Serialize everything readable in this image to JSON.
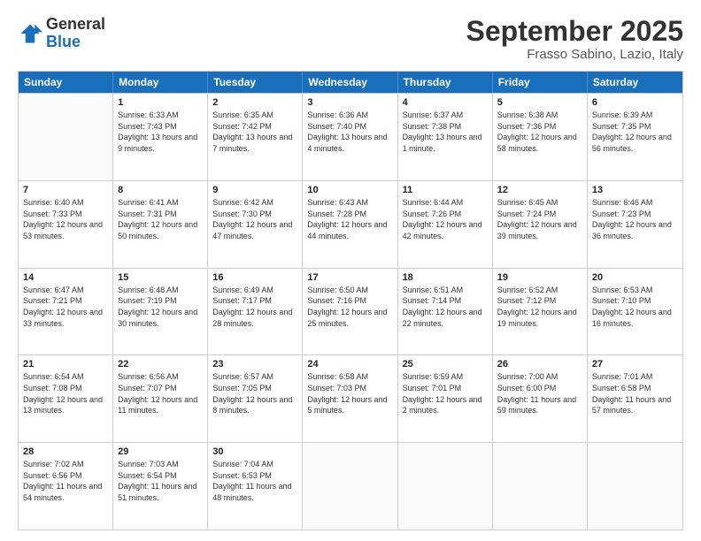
{
  "logo": {
    "general": "General",
    "blue": "Blue"
  },
  "header": {
    "month": "September 2025",
    "location": "Frasso Sabino, Lazio, Italy"
  },
  "days": [
    "Sunday",
    "Monday",
    "Tuesday",
    "Wednesday",
    "Thursday",
    "Friday",
    "Saturday"
  ],
  "rows": [
    [
      {
        "day": "",
        "sunrise": "",
        "sunset": "",
        "daylight": ""
      },
      {
        "day": "1",
        "sunrise": "Sunrise: 6:33 AM",
        "sunset": "Sunset: 7:43 PM",
        "daylight": "Daylight: 13 hours and 9 minutes."
      },
      {
        "day": "2",
        "sunrise": "Sunrise: 6:35 AM",
        "sunset": "Sunset: 7:42 PM",
        "daylight": "Daylight: 13 hours and 7 minutes."
      },
      {
        "day": "3",
        "sunrise": "Sunrise: 6:36 AM",
        "sunset": "Sunset: 7:40 PM",
        "daylight": "Daylight: 13 hours and 4 minutes."
      },
      {
        "day": "4",
        "sunrise": "Sunrise: 6:37 AM",
        "sunset": "Sunset: 7:38 PM",
        "daylight": "Daylight: 13 hours and 1 minute."
      },
      {
        "day": "5",
        "sunrise": "Sunrise: 6:38 AM",
        "sunset": "Sunset: 7:36 PM",
        "daylight": "Daylight: 12 hours and 58 minutes."
      },
      {
        "day": "6",
        "sunrise": "Sunrise: 6:39 AM",
        "sunset": "Sunset: 7:35 PM",
        "daylight": "Daylight: 12 hours and 56 minutes."
      }
    ],
    [
      {
        "day": "7",
        "sunrise": "Sunrise: 6:40 AM",
        "sunset": "Sunset: 7:33 PM",
        "daylight": "Daylight: 12 hours and 53 minutes."
      },
      {
        "day": "8",
        "sunrise": "Sunrise: 6:41 AM",
        "sunset": "Sunset: 7:31 PM",
        "daylight": "Daylight: 12 hours and 50 minutes."
      },
      {
        "day": "9",
        "sunrise": "Sunrise: 6:42 AM",
        "sunset": "Sunset: 7:30 PM",
        "daylight": "Daylight: 12 hours and 47 minutes."
      },
      {
        "day": "10",
        "sunrise": "Sunrise: 6:43 AM",
        "sunset": "Sunset: 7:28 PM",
        "daylight": "Daylight: 12 hours and 44 minutes."
      },
      {
        "day": "11",
        "sunrise": "Sunrise: 6:44 AM",
        "sunset": "Sunset: 7:26 PM",
        "daylight": "Daylight: 12 hours and 42 minutes."
      },
      {
        "day": "12",
        "sunrise": "Sunrise: 6:45 AM",
        "sunset": "Sunset: 7:24 PM",
        "daylight": "Daylight: 12 hours and 39 minutes."
      },
      {
        "day": "13",
        "sunrise": "Sunrise: 6:46 AM",
        "sunset": "Sunset: 7:23 PM",
        "daylight": "Daylight: 12 hours and 36 minutes."
      }
    ],
    [
      {
        "day": "14",
        "sunrise": "Sunrise: 6:47 AM",
        "sunset": "Sunset: 7:21 PM",
        "daylight": "Daylight: 12 hours and 33 minutes."
      },
      {
        "day": "15",
        "sunrise": "Sunrise: 6:48 AM",
        "sunset": "Sunset: 7:19 PM",
        "daylight": "Daylight: 12 hours and 30 minutes."
      },
      {
        "day": "16",
        "sunrise": "Sunrise: 6:49 AM",
        "sunset": "Sunset: 7:17 PM",
        "daylight": "Daylight: 12 hours and 28 minutes."
      },
      {
        "day": "17",
        "sunrise": "Sunrise: 6:50 AM",
        "sunset": "Sunset: 7:16 PM",
        "daylight": "Daylight: 12 hours and 25 minutes."
      },
      {
        "day": "18",
        "sunrise": "Sunrise: 6:51 AM",
        "sunset": "Sunset: 7:14 PM",
        "daylight": "Daylight: 12 hours and 22 minutes."
      },
      {
        "day": "19",
        "sunrise": "Sunrise: 6:52 AM",
        "sunset": "Sunset: 7:12 PM",
        "daylight": "Daylight: 12 hours and 19 minutes."
      },
      {
        "day": "20",
        "sunrise": "Sunrise: 6:53 AM",
        "sunset": "Sunset: 7:10 PM",
        "daylight": "Daylight: 12 hours and 16 minutes."
      }
    ],
    [
      {
        "day": "21",
        "sunrise": "Sunrise: 6:54 AM",
        "sunset": "Sunset: 7:08 PM",
        "daylight": "Daylight: 12 hours and 13 minutes."
      },
      {
        "day": "22",
        "sunrise": "Sunrise: 6:56 AM",
        "sunset": "Sunset: 7:07 PM",
        "daylight": "Daylight: 12 hours and 11 minutes."
      },
      {
        "day": "23",
        "sunrise": "Sunrise: 6:57 AM",
        "sunset": "Sunset: 7:05 PM",
        "daylight": "Daylight: 12 hours and 8 minutes."
      },
      {
        "day": "24",
        "sunrise": "Sunrise: 6:58 AM",
        "sunset": "Sunset: 7:03 PM",
        "daylight": "Daylight: 12 hours and 5 minutes."
      },
      {
        "day": "25",
        "sunrise": "Sunrise: 6:59 AM",
        "sunset": "Sunset: 7:01 PM",
        "daylight": "Daylight: 12 hours and 2 minutes."
      },
      {
        "day": "26",
        "sunrise": "Sunrise: 7:00 AM",
        "sunset": "Sunset: 6:00 PM",
        "daylight": "Daylight: 11 hours and 59 minutes."
      },
      {
        "day": "27",
        "sunrise": "Sunrise: 7:01 AM",
        "sunset": "Sunset: 6:58 PM",
        "daylight": "Daylight: 11 hours and 57 minutes."
      }
    ],
    [
      {
        "day": "28",
        "sunrise": "Sunrise: 7:02 AM",
        "sunset": "Sunset: 6:56 PM",
        "daylight": "Daylight: 11 hours and 54 minutes."
      },
      {
        "day": "29",
        "sunrise": "Sunrise: 7:03 AM",
        "sunset": "Sunset: 6:54 PM",
        "daylight": "Daylight: 11 hours and 51 minutes."
      },
      {
        "day": "30",
        "sunrise": "Sunrise: 7:04 AM",
        "sunset": "Sunset: 6:53 PM",
        "daylight": "Daylight: 11 hours and 48 minutes."
      },
      {
        "day": "",
        "sunrise": "",
        "sunset": "",
        "daylight": ""
      },
      {
        "day": "",
        "sunrise": "",
        "sunset": "",
        "daylight": ""
      },
      {
        "day": "",
        "sunrise": "",
        "sunset": "",
        "daylight": ""
      },
      {
        "day": "",
        "sunrise": "",
        "sunset": "",
        "daylight": ""
      }
    ]
  ]
}
